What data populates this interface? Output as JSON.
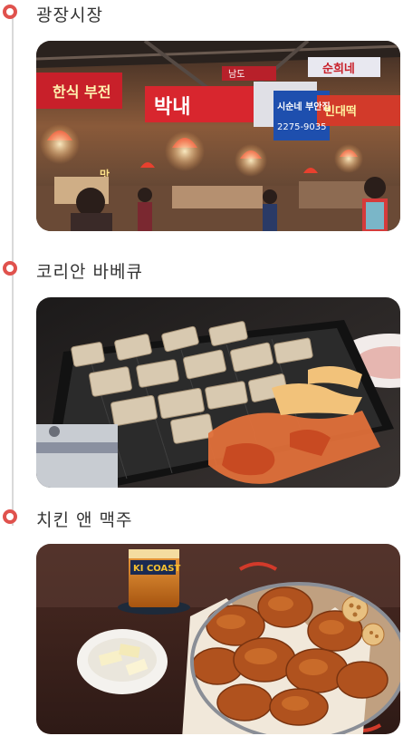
{
  "sections": [
    {
      "title": "광장시장",
      "photo": {
        "subject": "market-photo",
        "signs": [
          "박내",
          "시순네 부안집",
          "2275-9035",
          "순희네",
          "빈대떡",
          "남도",
          "한식 부전",
          "맛"
        ]
      }
    },
    {
      "title": "코리안 바베큐",
      "photo": {
        "subject": "bbq-photo"
      }
    },
    {
      "title": "치킨 앤 맥주",
      "photo": {
        "subject": "chicken-beer-photo",
        "coaster": "KI COAST"
      }
    }
  ],
  "colors": {
    "accent": "#e0524d",
    "line": "#d9d9d9",
    "text": "#333333"
  }
}
